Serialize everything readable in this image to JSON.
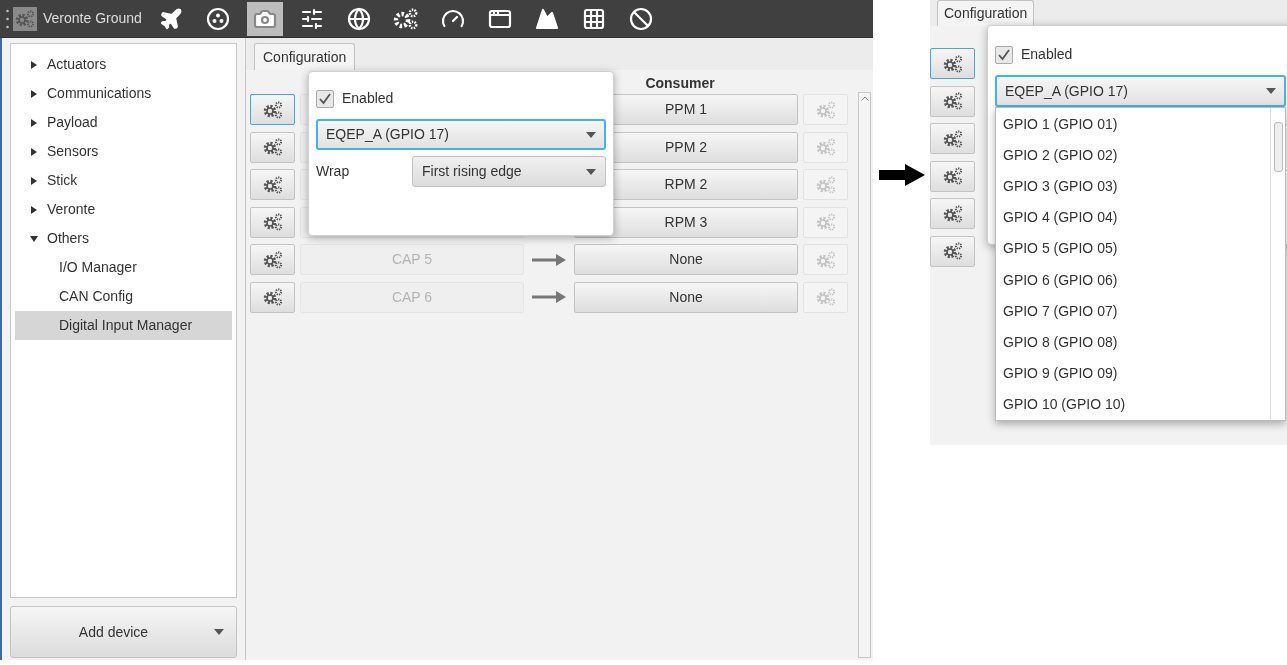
{
  "left_screen": {
    "toolbar": {
      "app_title": "Veronte Ground",
      "tools": [
        {
          "selected": false
        },
        {
          "selected": false
        },
        {
          "selected": true
        },
        {
          "selected": false
        },
        {
          "selected": false
        },
        {
          "selected": false
        },
        {
          "selected": false
        },
        {
          "selected": false
        },
        {
          "selected": false
        },
        {
          "selected": false
        },
        {
          "selected": false
        }
      ]
    },
    "tree": [
      {
        "label": "Actuators",
        "expanded": false
      },
      {
        "label": "Communications",
        "expanded": false
      },
      {
        "label": "Payload",
        "expanded": false
      },
      {
        "label": "Sensors",
        "expanded": false
      },
      {
        "label": "Stick",
        "expanded": false
      },
      {
        "label": "Veronte",
        "expanded": false
      },
      {
        "label": "Others",
        "expanded": true,
        "children": [
          {
            "label": "I/O Manager",
            "selected": false
          },
          {
            "label": "CAN Config",
            "selected": false
          },
          {
            "label": "Digital Input Manager",
            "selected": true
          }
        ]
      }
    ],
    "add_device_button": "Add device",
    "tab": {
      "label": "Configuration",
      "selected": true
    },
    "columns": {
      "consumer": "Consumer"
    },
    "rows": [
      {
        "consumer": "PPM 1",
        "selected": true
      },
      {
        "consumer": "PPM 2",
        "selected": false
      },
      {
        "consumer": "RPM 2",
        "selected": false
      },
      {
        "consumer": "RPM 3",
        "selected": false
      },
      {
        "producer": "CAP 5",
        "consumer": "None",
        "selected": false
      },
      {
        "producer": "CAP 6",
        "consumer": "None",
        "selected": false
      }
    ],
    "popup": {
      "enabled": {
        "label": "Enabled",
        "checked": true
      },
      "source": "EQEP_A (GPIO 17)",
      "wrap_label": "Wrap",
      "wrap_value": "First rising edge"
    }
  },
  "right_screen": {
    "tab": {
      "label": "Configuration",
      "selected": true
    },
    "rows": [
      {
        "selected": true
      },
      {
        "selected": false
      },
      {
        "selected": false
      },
      {
        "selected": false
      },
      {
        "selected": false
      },
      {
        "selected": false
      }
    ],
    "popup": {
      "enabled": {
        "label": "Enabled",
        "checked": true
      },
      "source": "EQEP_A (GPIO 17)",
      "options": [
        "GPIO 1 (GPIO 01)",
        "GPIO 2 (GPIO 02)",
        "GPIO 3 (GPIO 03)",
        "GPIO 4 (GPIO 04)",
        "GPIO 5 (GPIO 05)",
        "GPIO 6 (GPIO 06)",
        "GPIO 7 (GPIO 07)",
        "GPIO 8 (GPIO 08)",
        "GPIO 9 (GPIO 09)",
        "GPIO 10 (GPIO 10)"
      ]
    }
  }
}
